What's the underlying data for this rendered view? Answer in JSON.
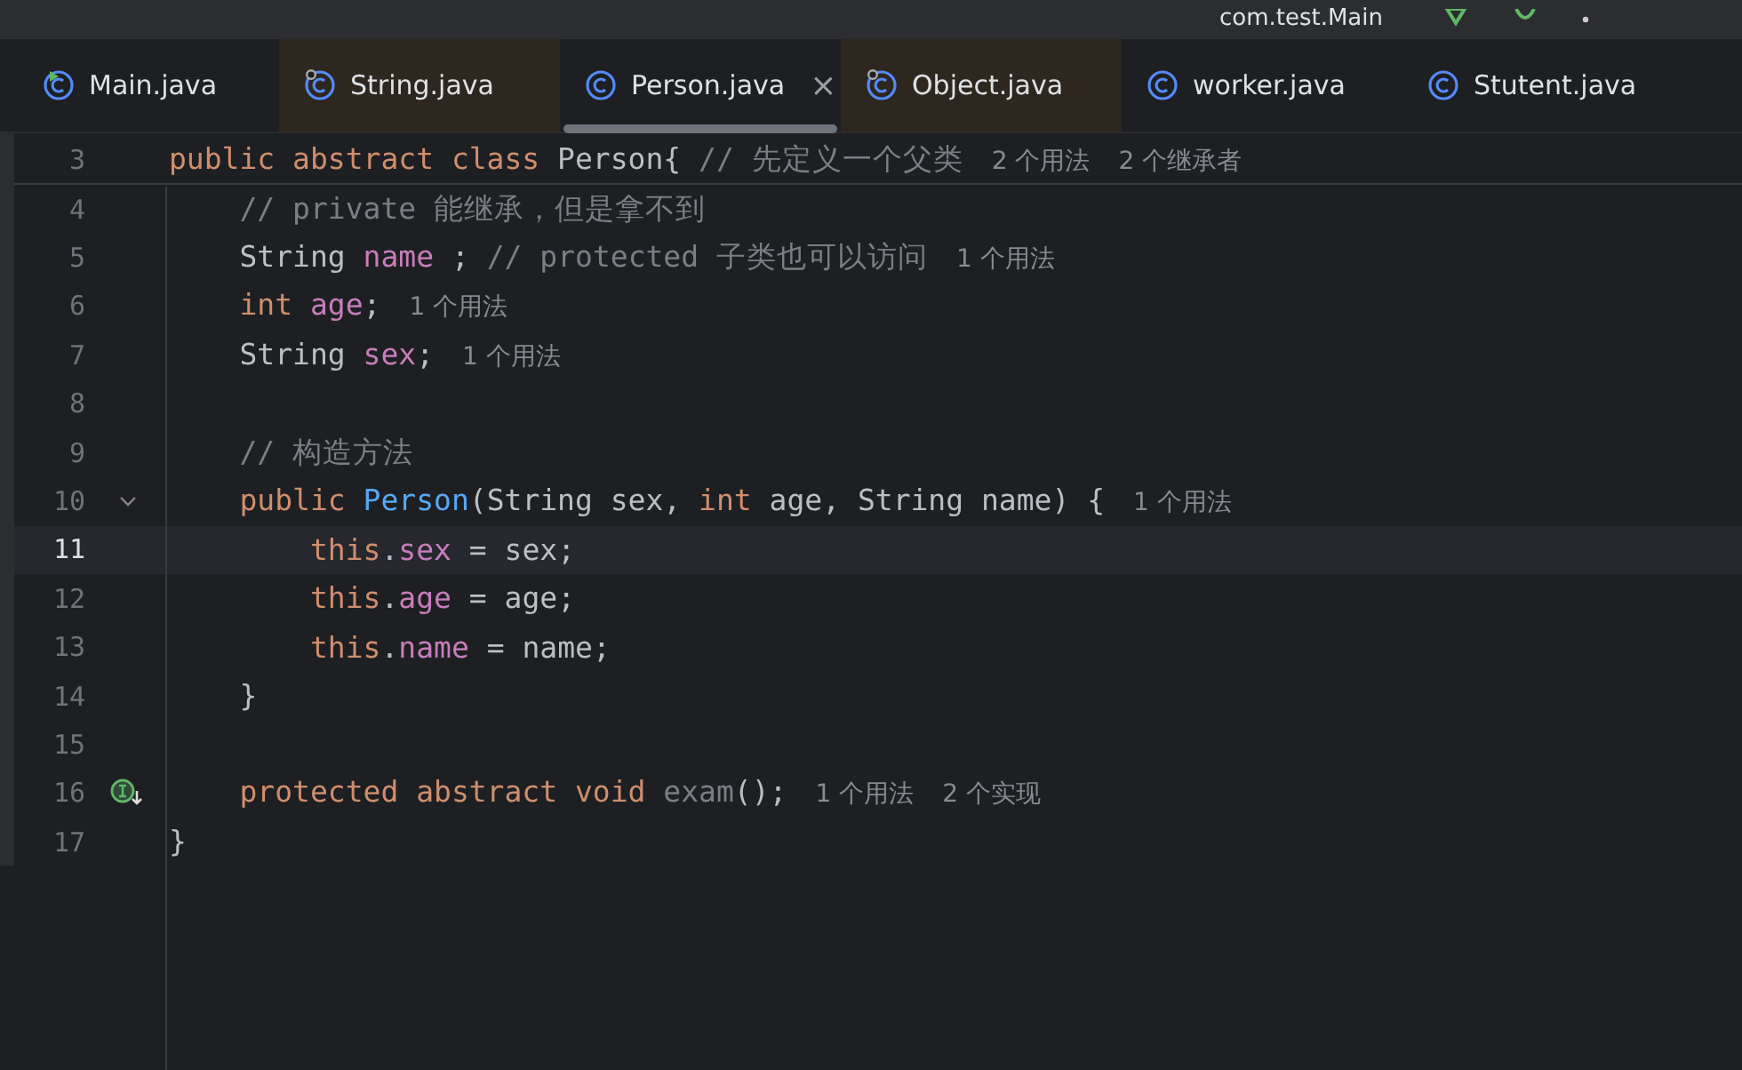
{
  "toolbar": {
    "run_config": "com.test.Main"
  },
  "tabs": [
    {
      "label": "Main.java",
      "selected": false,
      "library": false,
      "runnable": true
    },
    {
      "label": "String.java",
      "selected": false,
      "library": true,
      "runnable": false
    },
    {
      "label": "Person.java",
      "selected": true,
      "library": false,
      "runnable": false,
      "close": "×"
    },
    {
      "label": "Object.java",
      "selected": false,
      "library": true,
      "runnable": false
    },
    {
      "label": "worker.java",
      "selected": false,
      "library": false,
      "runnable": false
    },
    {
      "label": "Stutent.java",
      "selected": false,
      "library": false,
      "runnable": false
    }
  ],
  "editor": {
    "lines": [
      {
        "number": "3",
        "current": false,
        "sticky": true,
        "tokens": [
          {
            "kind": "kw",
            "text": "public abstract class "
          },
          {
            "kind": "plain",
            "text": "Person{ "
          },
          {
            "kind": "comment",
            "text": "// 先定义一个父类"
          },
          {
            "kind": "hint",
            "text": "2 个用法"
          },
          {
            "kind": "hint",
            "text": "2 个继承者"
          }
        ]
      },
      {
        "number": "4",
        "current": false,
        "tokens": [
          {
            "kind": "comment",
            "text": "    // private 能继承，但是拿不到"
          }
        ]
      },
      {
        "number": "5",
        "current": false,
        "tokens": [
          {
            "kind": "plain",
            "text": "    String "
          },
          {
            "kind": "field",
            "text": "name"
          },
          {
            "kind": "plain",
            "text": " ; "
          },
          {
            "kind": "comment",
            "text": "// protected 子类也可以访问"
          },
          {
            "kind": "hint",
            "text": "1 个用法"
          }
        ]
      },
      {
        "number": "6",
        "current": false,
        "tokens": [
          {
            "kind": "kw",
            "text": "    int "
          },
          {
            "kind": "field",
            "text": "age"
          },
          {
            "kind": "plain",
            "text": ";"
          },
          {
            "kind": "hint",
            "text": "1 个用法"
          }
        ]
      },
      {
        "number": "7",
        "current": false,
        "tokens": [
          {
            "kind": "plain",
            "text": "    String "
          },
          {
            "kind": "field",
            "text": "sex"
          },
          {
            "kind": "plain",
            "text": ";"
          },
          {
            "kind": "hint",
            "text": "1 个用法"
          }
        ]
      },
      {
        "number": "8",
        "current": false
      },
      {
        "number": "9",
        "current": false,
        "tokens": [
          {
            "kind": "comment",
            "text": "    // 构造方法"
          }
        ]
      },
      {
        "number": "10",
        "current": false,
        "foldable": true,
        "tokens": [
          {
            "kind": "kw",
            "text": "    public "
          },
          {
            "kind": "method",
            "text": "Person"
          },
          {
            "kind": "plain",
            "text": "(String sex, "
          },
          {
            "kind": "kw",
            "text": "int "
          },
          {
            "kind": "plain",
            "text": "age, String name) {"
          },
          {
            "kind": "hint",
            "text": "1 个用法"
          }
        ]
      },
      {
        "number": "11",
        "current": true,
        "tokens": [
          {
            "kind": "kw",
            "text": "        this"
          },
          {
            "kind": "plain",
            "text": "."
          },
          {
            "kind": "field",
            "text": "sex"
          },
          {
            "kind": "plain",
            "text": " = sex;"
          }
        ]
      },
      {
        "number": "12",
        "current": false,
        "tokens": [
          {
            "kind": "kw",
            "text": "        this"
          },
          {
            "kind": "plain",
            "text": "."
          },
          {
            "kind": "field",
            "text": "age"
          },
          {
            "kind": "plain",
            "text": " = age;"
          }
        ]
      },
      {
        "number": "13",
        "current": false,
        "tokens": [
          {
            "kind": "kw",
            "text": "        this"
          },
          {
            "kind": "plain",
            "text": "."
          },
          {
            "kind": "field",
            "text": "name"
          },
          {
            "kind": "plain",
            "text": " = name;"
          }
        ]
      },
      {
        "number": "14",
        "current": false,
        "tokens": [
          {
            "kind": "plain",
            "text": "    }"
          }
        ]
      },
      {
        "number": "15",
        "current": false
      },
      {
        "number": "16",
        "current": false,
        "implemented": true,
        "tokens": [
          {
            "kind": "kw",
            "text": "    protected abstract void "
          },
          {
            "kind": "unused",
            "text": "exam"
          },
          {
            "kind": "plain",
            "text": "();"
          },
          {
            "kind": "hint",
            "text": "1 个用法"
          },
          {
            "kind": "hint",
            "text": "2 个实现"
          }
        ]
      },
      {
        "number": "17",
        "current": false,
        "tokens": [
          {
            "kind": "plain",
            "text": "}"
          }
        ]
      }
    ]
  }
}
